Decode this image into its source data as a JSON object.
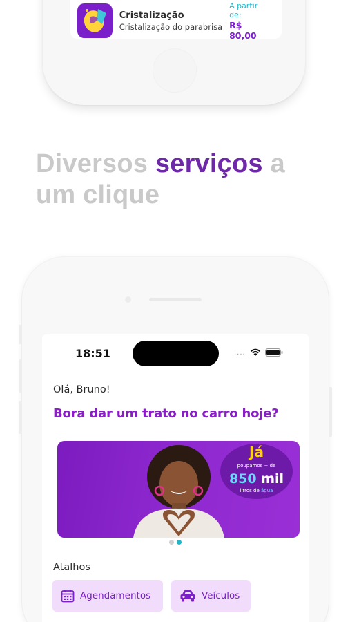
{
  "top_card": {
    "title": "Cristalização",
    "description": "Cristalização do parabrisa",
    "price_label": "A partir de:",
    "price_value": "R$ 80,00"
  },
  "headline": {
    "part1": "Diversos ",
    "accent": "serviços",
    "part2": " a",
    "line2": "um clique"
  },
  "status_bar": {
    "time": "18:51",
    "dots": "...."
  },
  "app": {
    "greeting": "Olá, Bruno!",
    "subtitle": "Bora dar um trato no carro hoje?",
    "banner": {
      "badge_title": "Já",
      "badge_line1": "poupamos + de",
      "badge_number": "850",
      "badge_unit": " mil",
      "badge_line3_a": "litros de ",
      "badge_line3_b": "água"
    },
    "carousel": {
      "total": 2,
      "active": 2
    },
    "shortcuts_title": "Atalhos",
    "shortcuts": [
      {
        "label": "Agendamentos",
        "icon": "calendar-icon"
      },
      {
        "label": "Veículos",
        "icon": "car-icon"
      }
    ]
  },
  "colors": {
    "brand_purple": "#7a1fc9",
    "accent_cyan": "#1fb6c9",
    "headline_gray": "#c9c9c9",
    "shortcut_bg": "#f2dcfb"
  }
}
